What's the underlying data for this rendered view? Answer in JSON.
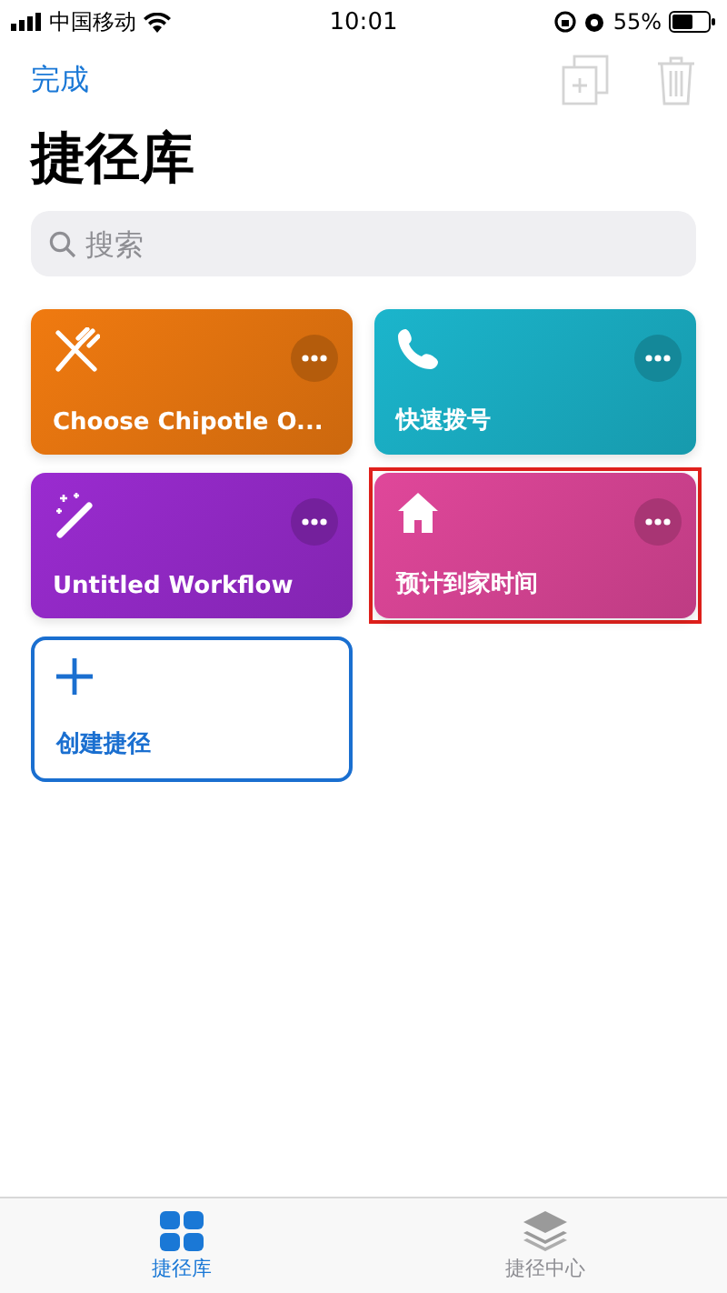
{
  "status_bar": {
    "carrier": "中国移动",
    "time": "10:01",
    "battery": "55%"
  },
  "nav": {
    "done": "完成",
    "actions": [
      {
        "kind": "duplicate",
        "disabled": true
      },
      {
        "kind": "delete",
        "disabled": true
      }
    ]
  },
  "title": "捷径库",
  "search": {
    "placeholder": "搜索"
  },
  "cards": [
    {
      "kind": "shortcut",
      "label": "Choose Chipotle O...",
      "color": "#f07a10",
      "highlighted": false
    },
    {
      "kind": "shortcut",
      "label": "快速拨号",
      "color": "#1bb5cc",
      "highlighted": false
    },
    {
      "kind": "shortcut",
      "label": "Untitled Workflow",
      "color": "#9a2bd0",
      "highlighted": false
    },
    {
      "kind": "shortcut",
      "label": "预计到家时间",
      "color": "#e0479a",
      "highlighted": true
    },
    {
      "kind": "create",
      "label": "创建捷径"
    }
  ],
  "tabs": [
    {
      "label": "捷径库",
      "selected": true
    },
    {
      "label": "捷径中心",
      "selected": false
    }
  ]
}
